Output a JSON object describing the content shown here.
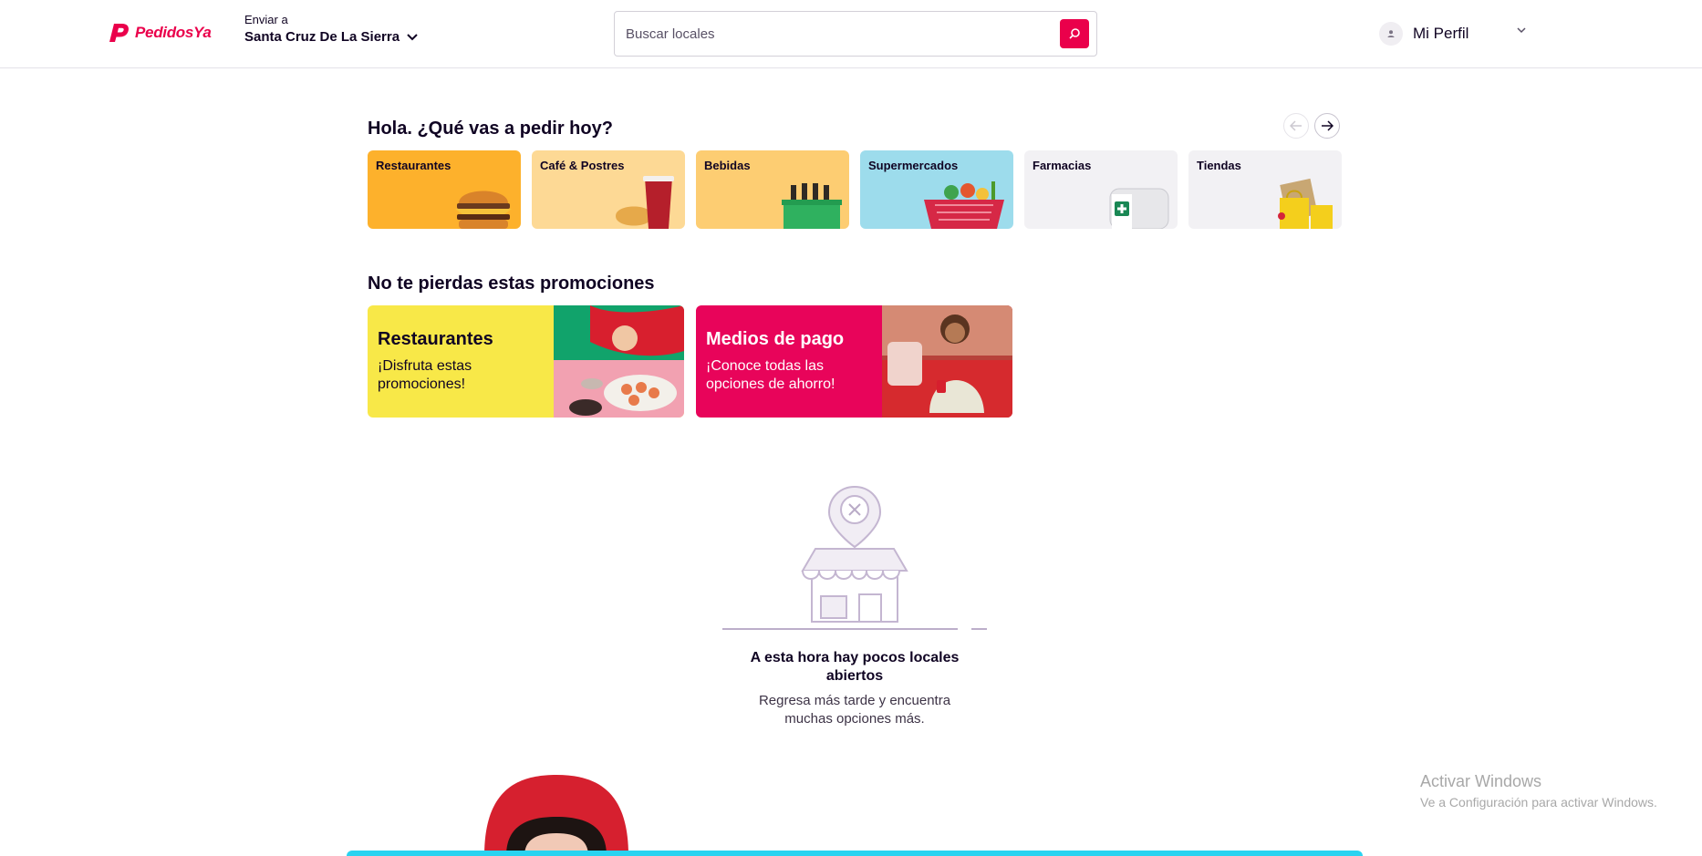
{
  "header": {
    "brand": "PedidosYa",
    "address_label": "Enviar a",
    "address_value": "Santa Cruz De La Sierra",
    "search_placeholder": "Buscar locales",
    "profile_name": "Mi Perfil"
  },
  "greeting": "Hola. ¿Qué vas a pedir hoy?",
  "categories": [
    {
      "label": "Restaurantes",
      "color": "#fdb12c"
    },
    {
      "label": "Café & Postres",
      "color": "#fdd995"
    },
    {
      "label": "Bebidas",
      "color": "#fdcd72"
    },
    {
      "label": "Supermercados",
      "color": "#9ddcec"
    },
    {
      "label": "Farmacias",
      "color": "#f2f1f4"
    },
    {
      "label": "Tiendas",
      "color": "#f2f1f4"
    }
  ],
  "promos_title": "No te pierdas estas promociones",
  "promos": [
    {
      "title": "Restaurantes",
      "subtitle": "¡Disfruta estas promociones!",
      "color": "#f8e848"
    },
    {
      "title": "Medios de pago",
      "subtitle": "¡Conoce todas las opciones de ahorro!",
      "color": "#e8045a"
    }
  ],
  "empty_state": {
    "title": "A esta hora hay pocos locales abiertos",
    "subtitle": "Regresa más tarde y encuentra muchas opciones más."
  },
  "watermark": {
    "title": "Activar Windows",
    "subtitle": "Ve a Configuración para activar Windows."
  },
  "colors": {
    "brand": "#ea004b",
    "text": "#100423",
    "accent_strip": "#29d3f0"
  }
}
